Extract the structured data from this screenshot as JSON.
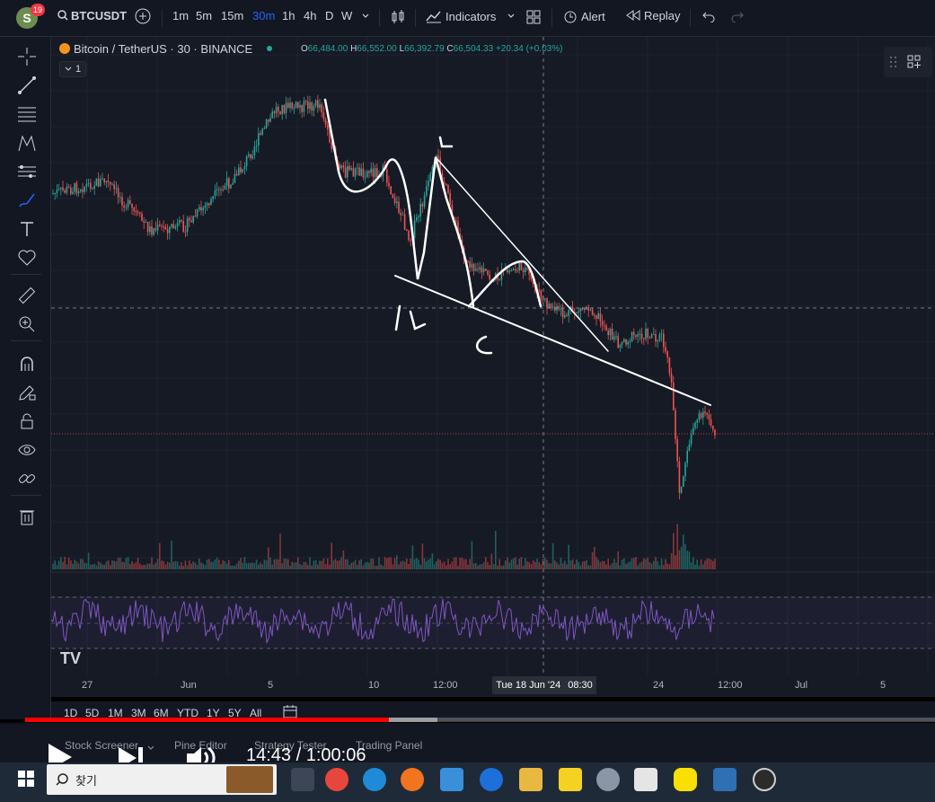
{
  "app": {
    "avatar_letter": "S",
    "notification_count": "19"
  },
  "toolbar": {
    "symbol": "BTCUSDT",
    "intervals": [
      "1m",
      "5m",
      "15m",
      "30m",
      "1h",
      "4h",
      "D",
      "W"
    ],
    "active_interval": "30m",
    "indicators_label": "Indicators",
    "alert_label": "Alert",
    "replay_label": "Replay"
  },
  "legend": {
    "title": "Bitcoin / TetherUS · 30 · BINANCE",
    "open_label": "O",
    "open": "66,484.00",
    "high_label": "H",
    "high": "66,552.00",
    "low_label": "L",
    "low": "66,392.79",
    "close_label": "C",
    "close": "66,504.33",
    "change": "+20.34 (+0.03%)",
    "collapse_label": "1"
  },
  "annotations": [
    "ㄴ",
    "ㄴ",
    "c"
  ],
  "x_axis": {
    "labels": [
      "27",
      "Jun",
      "5",
      "10",
      "12:00",
      "24",
      "12:00",
      "Jul",
      "5"
    ],
    "crosshair_date": "Tue 18 Jun '24",
    "crosshair_time": "08:30"
  },
  "ranges": [
    "1D",
    "5D",
    "1M",
    "3M",
    "6M",
    "YTD",
    "1Y",
    "5Y",
    "All"
  ],
  "panel_tabs": [
    "Stock Screener",
    "Pine Editor",
    "Strategy Tester",
    "Trading Panel"
  ],
  "player": {
    "time": "14:43 / 1:00:06",
    "progress_fraction": 0.4
  },
  "taskbar": {
    "search_placeholder": "찾기"
  },
  "colors": {
    "background": "#161a25",
    "up": "#26a69a",
    "down": "#ef5350",
    "rsi": "#7e57c2",
    "accent": "#2962ff",
    "progress": "#ff0000"
  }
}
